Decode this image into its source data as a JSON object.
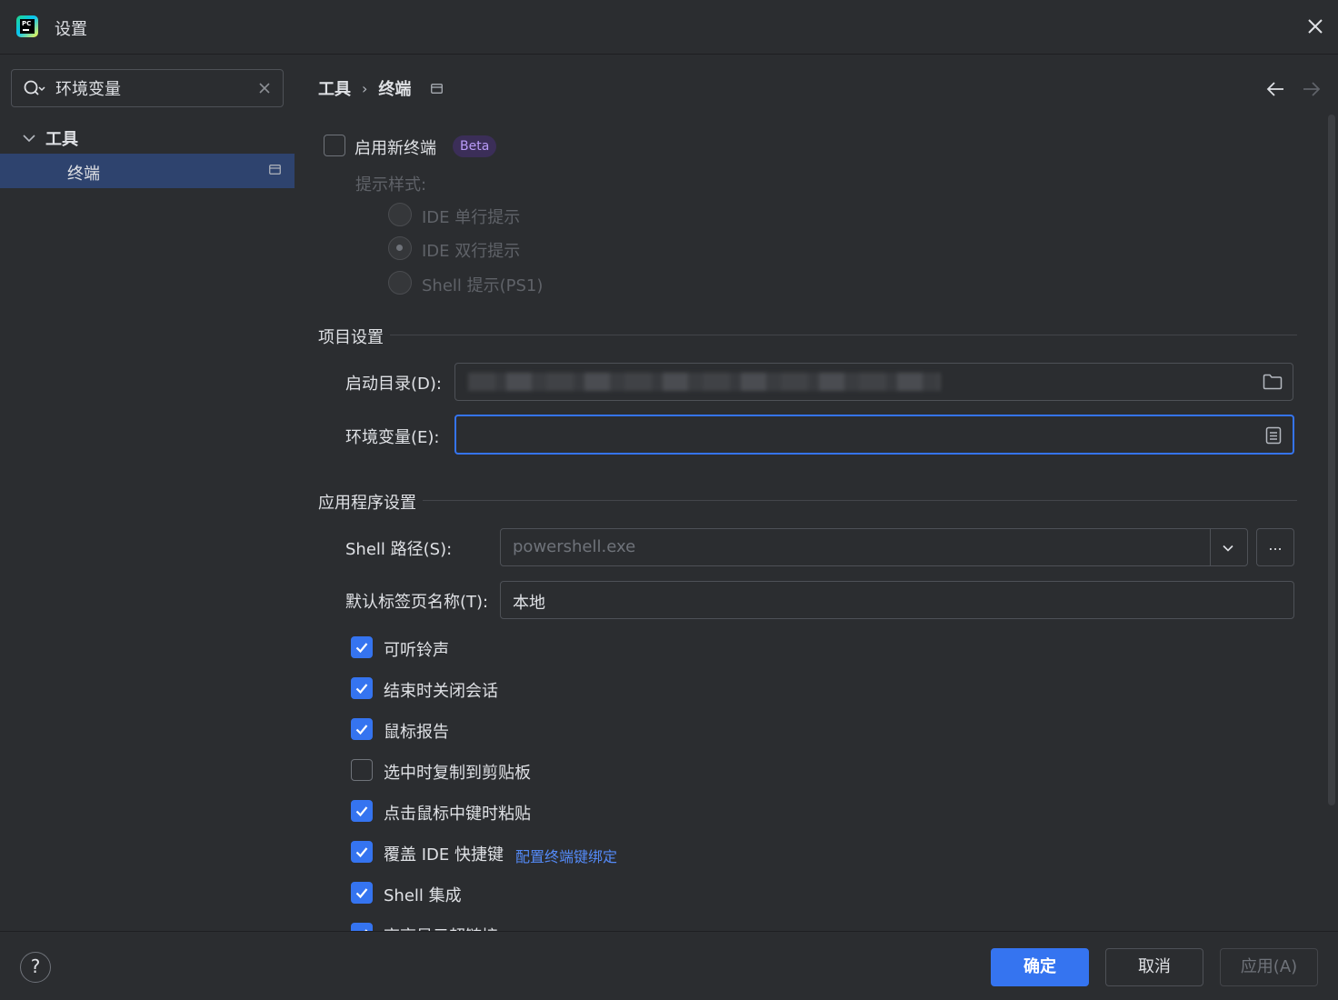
{
  "window": {
    "title": "设置",
    "logo_text": "PC"
  },
  "search": {
    "value": "环境变量"
  },
  "tree": {
    "root_label": "工具",
    "child_label": "终端"
  },
  "breadcrumb": {
    "parent": "工具",
    "current": "终端"
  },
  "new_terminal": {
    "label": "启用新终端",
    "checked": false,
    "badge": "Beta"
  },
  "prompt_style": {
    "label": "提示样式:",
    "options": [
      {
        "label": "IDE 单行提示",
        "selected": false
      },
      {
        "label": "IDE 双行提示",
        "selected": true
      },
      {
        "label": "Shell 提示(PS1)",
        "selected": false
      }
    ]
  },
  "project_settings": {
    "title": "项目设置",
    "start_dir_label": "启动目录(D):",
    "env_vars_label": "环境变量(E):",
    "env_vars_value": ""
  },
  "app_settings": {
    "title": "应用程序设置",
    "shell_path_label": "Shell 路径(S):",
    "shell_path_placeholder": "powershell.exe",
    "more_label": "...",
    "tab_name_label": "默认标签页名称(T):",
    "tab_name_value": "本地"
  },
  "options": [
    {
      "label": "可听铃声",
      "checked": true
    },
    {
      "label": "结束时关闭会话",
      "checked": true
    },
    {
      "label": "鼠标报告",
      "checked": true
    },
    {
      "label": "选中时复制到剪贴板",
      "checked": false
    },
    {
      "label": "点击鼠标中键时粘贴",
      "checked": true
    },
    {
      "label": "覆盖 IDE 快捷键",
      "checked": true,
      "link": "配置终端键绑定"
    },
    {
      "label": "Shell 集成",
      "checked": true
    },
    {
      "label": "高亮显示超链接",
      "checked": true
    }
  ],
  "footer": {
    "help": "?",
    "ok": "确定",
    "cancel": "取消",
    "apply": "应用(A)"
  },
  "colors": {
    "accent": "#3574f0",
    "background": "#2b2d30",
    "selection": "#2e436e",
    "beta_bg": "#3b2e58",
    "link": "#548af7"
  }
}
